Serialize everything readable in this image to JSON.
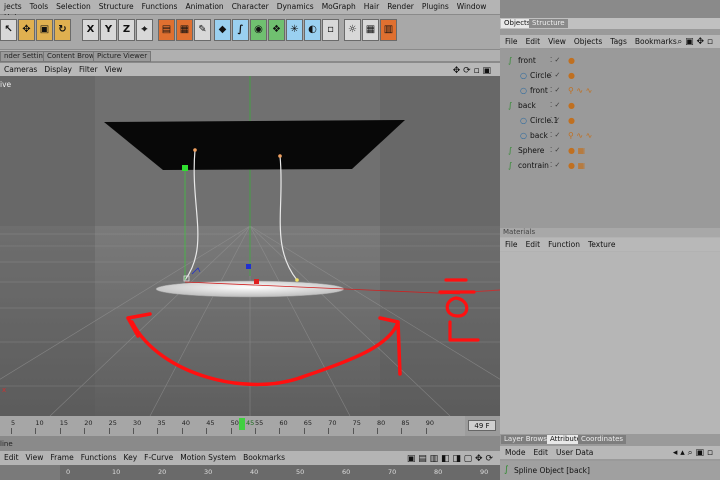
{
  "menu": [
    "jects",
    "Tools",
    "Selection",
    "Structure",
    "Functions",
    "Animation",
    "Character",
    "Dynamics",
    "MoGraph",
    "Hair",
    "Render",
    "Plugins",
    "Window",
    "Help"
  ],
  "toolbar_axes": [
    "X",
    "Y",
    "Z"
  ],
  "viewport_tabs": [
    "nder Settings",
    "Content Browser",
    "Picture Viewer"
  ],
  "viewport_menu": [
    "Cameras",
    "Display",
    "Filter",
    "View"
  ],
  "viewport_label": "ive",
  "timeline": {
    "ticks": [
      "5",
      "10",
      "15",
      "20",
      "25",
      "30",
      "35",
      "40",
      "45",
      "50",
      "55",
      "60",
      "65",
      "70",
      "75",
      "80",
      "85",
      "90"
    ],
    "frame_field": "49 F",
    "current_frame": "45",
    "lower_label": "line",
    "menu": [
      "Edit",
      "View",
      "Frame",
      "Functions",
      "Key",
      "F-Curve",
      "Motion System",
      "Bookmarks"
    ],
    "lower_ticks": [
      "0",
      "10",
      "20",
      "30",
      "40",
      "50",
      "60",
      "70",
      "80",
      "90"
    ]
  },
  "objects_panel": {
    "tabs": [
      "Objects",
      "Structure"
    ],
    "menu": [
      "File",
      "Edit",
      "View",
      "Objects",
      "Tags",
      "Bookmarks"
    ],
    "rows": [
      {
        "label": "front",
        "indent": 0
      },
      {
        "label": "Circle",
        "indent": 1
      },
      {
        "label": "front",
        "indent": 1
      },
      {
        "label": "back",
        "indent": 0
      },
      {
        "label": "Circle.1",
        "indent": 1
      },
      {
        "label": "back",
        "indent": 1
      },
      {
        "label": "Sphere",
        "indent": 0
      },
      {
        "label": "contrain",
        "indent": 0
      }
    ]
  },
  "materials_panel": {
    "title": "Materials",
    "menu": [
      "File",
      "Edit",
      "Function",
      "Texture"
    ]
  },
  "attributes_panel": {
    "tabs": [
      "Layer Browser",
      "Attributes",
      "Coordinates"
    ],
    "menu": [
      "Mode",
      "Edit",
      "User Data"
    ],
    "object_label": "Spline Object [back]"
  },
  "colors": {
    "annotation_red": "#ff1010",
    "viewport_bg": "#6c6c6c",
    "panel_bg": "#9a9a9a"
  }
}
